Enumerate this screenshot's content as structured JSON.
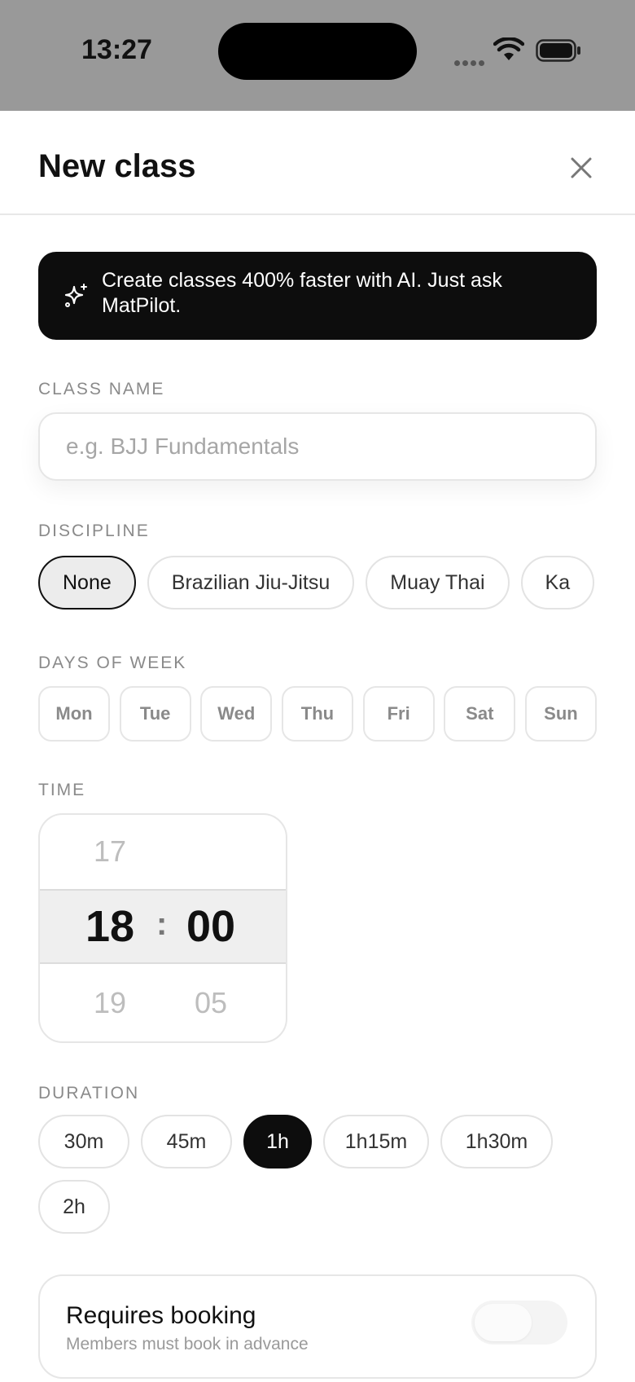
{
  "status_bar": {
    "time": "13:27",
    "wifi_icon": "wifi-icon",
    "battery_icon": "battery-icon"
  },
  "header": {
    "title": "New class",
    "close_icon": "close-icon"
  },
  "ai_banner": {
    "icon": "sparkle-icon",
    "text": "Create classes 400% faster with AI. Just ask MatPilot."
  },
  "class_name": {
    "label": "CLASS NAME",
    "value": "",
    "placeholder": "e.g. BJJ Fundamentals"
  },
  "discipline": {
    "label": "DISCIPLINE",
    "options": [
      "None",
      "Brazilian Jiu-Jitsu",
      "Muay Thai",
      "Ka"
    ],
    "selected": "None"
  },
  "days_of_week": {
    "label": "DAYS OF WEEK",
    "days": [
      "Mon",
      "Tue",
      "Wed",
      "Thu",
      "Fri",
      "Sat",
      "Sun"
    ]
  },
  "time": {
    "label": "TIME",
    "hour_prev": "17",
    "hour": "18",
    "hour_next": "19",
    "minute_prev": "",
    "minute": "00",
    "minute_next": "05",
    "separator": ":"
  },
  "duration": {
    "label": "DURATION",
    "options": [
      "30m",
      "45m",
      "1h",
      "1h15m",
      "1h30m",
      "2h"
    ],
    "selected": "1h"
  },
  "booking": {
    "title": "Requires booking",
    "subtitle": "Members must book in advance",
    "enabled": false
  },
  "colors": {
    "accent": "#0d0d0d",
    "status_bar_bg": "#999999"
  }
}
